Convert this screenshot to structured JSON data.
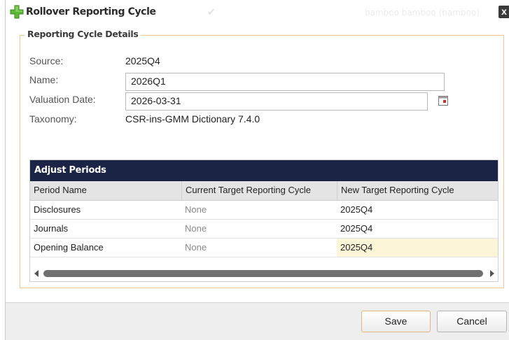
{
  "dialog": {
    "title": "Rollover Reporting Cycle",
    "user_text": "bamboo bamboo (bamboo)",
    "close_glyph": "x",
    "title_icon": "green-plus-icon"
  },
  "fieldset": {
    "legend": "Reporting Cycle Details"
  },
  "fields": {
    "source_label": "Source:",
    "source_value": "2025Q4",
    "name_label": "Name:",
    "name_value": "2026Q1",
    "valuation_date_label": "Valuation Date:",
    "valuation_date_value": "2026-03-31",
    "taxonomy_label": "Taxonomy:",
    "taxonomy_value": "CSR-ins-GMM Dictionary 7.4.0"
  },
  "grid": {
    "title": "Adjust Periods",
    "columns": [
      "Period Name",
      "Current Target Reporting Cycle",
      "New Target Reporting Cycle"
    ],
    "rows": [
      [
        "Disclosures",
        "None",
        "2025Q4"
      ],
      [
        "Journals",
        "None",
        "2025Q4"
      ],
      [
        "Opening Balance",
        "None",
        "2025Q4"
      ]
    ]
  },
  "buttons": {
    "save": "Save",
    "cancel": "Cancel"
  },
  "colors": {
    "grid_title_bg": "#1c2445",
    "fieldset_border": "#f2c98a",
    "selected_cell": "#fdf5d8"
  }
}
